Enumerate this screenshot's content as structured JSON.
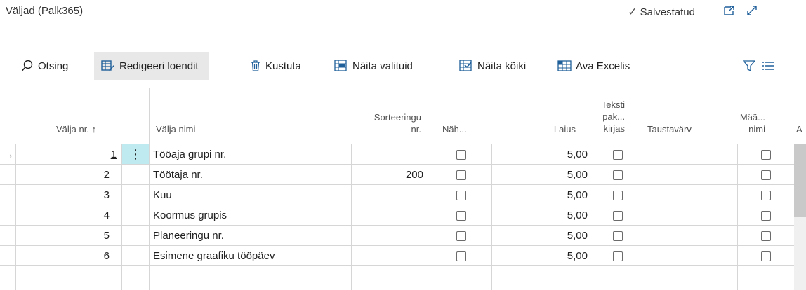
{
  "header": {
    "title": "Väljad (Palk365)",
    "saved_status": "Salvestatud"
  },
  "actions": {
    "search": "Otsing",
    "edit_list": "Redigeeri loendit",
    "delete": "Kustuta",
    "show_selected": "Näita valituid",
    "show_all": "Näita kõiki",
    "open_excel": "Ava Excelis"
  },
  "columns": {
    "field_no": "Välja nr.",
    "sort_arrow": "↑",
    "field_name": "Välja nimi",
    "sort_no_1": "Sorteeringu",
    "sort_no_2": "nr.",
    "visible": "Näh...",
    "width": "Laius",
    "textwrap_1": "Teksti",
    "textwrap_2": "pak...",
    "textwrap_3": "kirjas",
    "bgcolor": "Taustavärv",
    "defname_1": "Mää...",
    "defname_2": "nimi",
    "cut": "A"
  },
  "rows": [
    {
      "no": "1",
      "name": "Tööaja grupi nr.",
      "sort": "",
      "visible": false,
      "width": "5,00",
      "wrap": false,
      "bg": "",
      "def": false
    },
    {
      "no": "2",
      "name": "Töötaja nr.",
      "sort": "200",
      "visible": false,
      "width": "5,00",
      "wrap": false,
      "bg": "",
      "def": false
    },
    {
      "no": "3",
      "name": "Kuu",
      "sort": "",
      "visible": false,
      "width": "5,00",
      "wrap": false,
      "bg": "",
      "def": false
    },
    {
      "no": "4",
      "name": "Koormus grupis",
      "sort": "",
      "visible": false,
      "width": "5,00",
      "wrap": false,
      "bg": "",
      "def": false
    },
    {
      "no": "5",
      "name": "Planeeringu nr.",
      "sort": "",
      "visible": false,
      "width": "5,00",
      "wrap": false,
      "bg": "",
      "def": false
    },
    {
      "no": "6",
      "name": "Esimene graafiku tööpäev",
      "sort": "",
      "visible": false,
      "width": "5,00",
      "wrap": false,
      "bg": "",
      "def": false
    }
  ],
  "row_markers": {
    "selected_arrow": "→",
    "row_menu": "⋮"
  },
  "colors": {
    "accent": "#00838f",
    "selected_cell": "#bfeaf0"
  }
}
